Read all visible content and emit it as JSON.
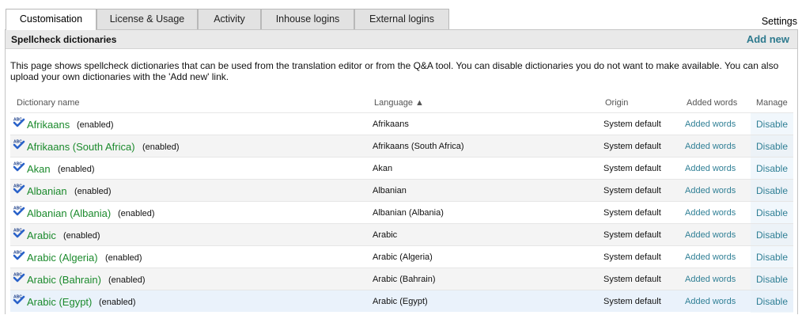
{
  "tabs": [
    {
      "label": "Customisation",
      "active": true
    },
    {
      "label": "License & Usage",
      "active": false
    },
    {
      "label": "Activity",
      "active": false
    },
    {
      "label": "Inhouse logins",
      "active": false
    },
    {
      "label": "External logins",
      "active": false
    }
  ],
  "settings_label": "Settings",
  "panel": {
    "title": "Spellcheck dictionaries",
    "add_new": "Add new",
    "description": "This page shows spellcheck dictionaries that can be used from the translation editor or from the Q&A tool. You can disable dictionaries you do not want to make available. You can also upload your own dictionaries with the 'Add new' link."
  },
  "table": {
    "headers": {
      "name": "Dictionary name",
      "language": "Language ▲",
      "origin": "Origin",
      "added_words": "Added words",
      "manage": "Manage"
    },
    "rows": [
      {
        "name": "Afrikaans",
        "status": "(enabled)",
        "language": "Afrikaans",
        "origin": "System default",
        "added_words": "Added words",
        "manage": "Disable"
      },
      {
        "name": "Afrikaans (South Africa)",
        "status": "(enabled)",
        "language": "Afrikaans (South Africa)",
        "origin": "System default",
        "added_words": "Added words",
        "manage": "Disable"
      },
      {
        "name": "Akan",
        "status": "(enabled)",
        "language": "Akan",
        "origin": "System default",
        "added_words": "Added words",
        "manage": "Disable"
      },
      {
        "name": "Albanian",
        "status": "(enabled)",
        "language": "Albanian",
        "origin": "System default",
        "added_words": "Added words",
        "manage": "Disable"
      },
      {
        "name": "Albanian (Albania)",
        "status": "(enabled)",
        "language": "Albanian (Albania)",
        "origin": "System default",
        "added_words": "Added words",
        "manage": "Disable"
      },
      {
        "name": "Arabic",
        "status": "(enabled)",
        "language": "Arabic",
        "origin": "System default",
        "added_words": "Added words",
        "manage": "Disable"
      },
      {
        "name": "Arabic (Algeria)",
        "status": "(enabled)",
        "language": "Arabic (Algeria)",
        "origin": "System default",
        "added_words": "Added words",
        "manage": "Disable"
      },
      {
        "name": "Arabic (Bahrain)",
        "status": "(enabled)",
        "language": "Arabic (Bahrain)",
        "origin": "System default",
        "added_words": "Added words",
        "manage": "Disable"
      },
      {
        "name": "Arabic (Egypt)",
        "status": "(enabled)",
        "language": "Arabic (Egypt)",
        "origin": "System default",
        "added_words": "Added words",
        "manage": "Disable"
      }
    ]
  },
  "icons": {
    "dictionary": "abc-checkmark-icon"
  },
  "colors": {
    "link_green": "#1b8a2c",
    "link_teal": "#2f7f95",
    "header_bg": "#e9e9e9"
  }
}
